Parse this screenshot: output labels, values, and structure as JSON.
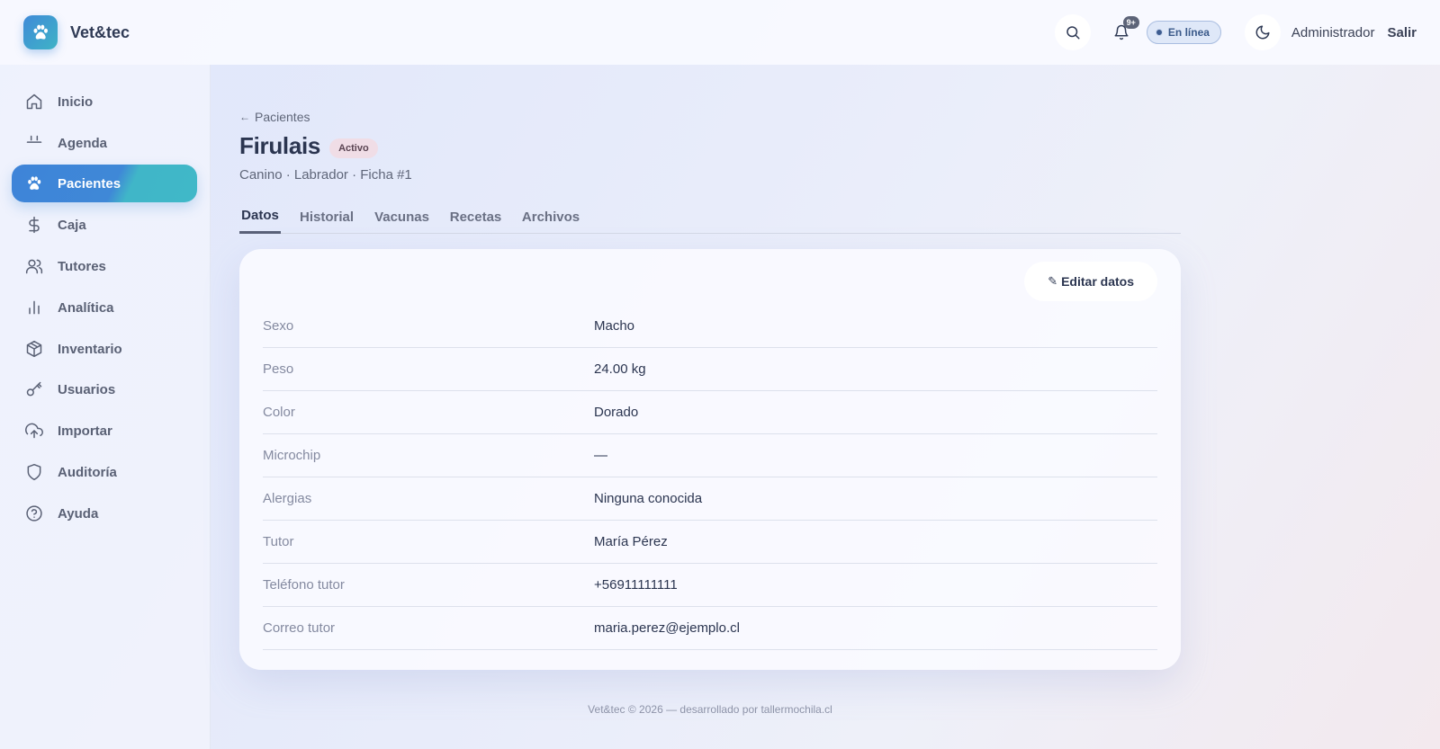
{
  "header": {
    "brand": "Vet&tec",
    "notification_count": "9+",
    "status": "En línea",
    "user": "Administrador",
    "logout": "Salir"
  },
  "sidebar": {
    "items": [
      {
        "label": "Inicio",
        "icon": "home-icon"
      },
      {
        "label": "Agenda",
        "icon": "calendar-icon"
      },
      {
        "label": "Pacientes",
        "icon": "paw-icon",
        "active": true
      },
      {
        "label": "Caja",
        "icon": "dollar-icon"
      },
      {
        "label": "Tutores",
        "icon": "users-icon"
      },
      {
        "label": "Analítica",
        "icon": "bar-chart-icon"
      },
      {
        "label": "Inventario",
        "icon": "box-icon"
      },
      {
        "label": "Usuarios",
        "icon": "key-icon"
      },
      {
        "label": "Importar",
        "icon": "upload-cloud-icon"
      },
      {
        "label": "Auditoría",
        "icon": "shield-icon"
      },
      {
        "label": "Ayuda",
        "icon": "help-circle-icon"
      }
    ]
  },
  "patient": {
    "back_label": "Pacientes",
    "back_arrow": "←",
    "name": "Firulais",
    "status": "Activo",
    "subtitle": "Canino · Labrador · Ficha #1"
  },
  "tabs": [
    "Datos",
    "Historial",
    "Vacunas",
    "Recetas",
    "Archivos"
  ],
  "card": {
    "edit_icon": "✎",
    "edit_label": "Editar datos",
    "fields": [
      {
        "label": "Sexo",
        "value": "Macho"
      },
      {
        "label": "Peso",
        "value": "24.00 kg"
      },
      {
        "label": "Color",
        "value": "Dorado"
      },
      {
        "label": "Microchip",
        "value": "—"
      },
      {
        "label": "Alergias",
        "value": "Ninguna conocida"
      },
      {
        "label": "Tutor",
        "value": "María Pérez"
      },
      {
        "label": "Teléfono tutor",
        "value": "+56911111111"
      },
      {
        "label": "Correo tutor",
        "value": "maria.perez@ejemplo.cl"
      }
    ]
  },
  "footer": "Vet&tec © 2026 — desarrollado por tallermochila.cl",
  "colors": {
    "accent": "#3e84d8",
    "accent2": "#40b8c8",
    "text": "#2b3550"
  }
}
